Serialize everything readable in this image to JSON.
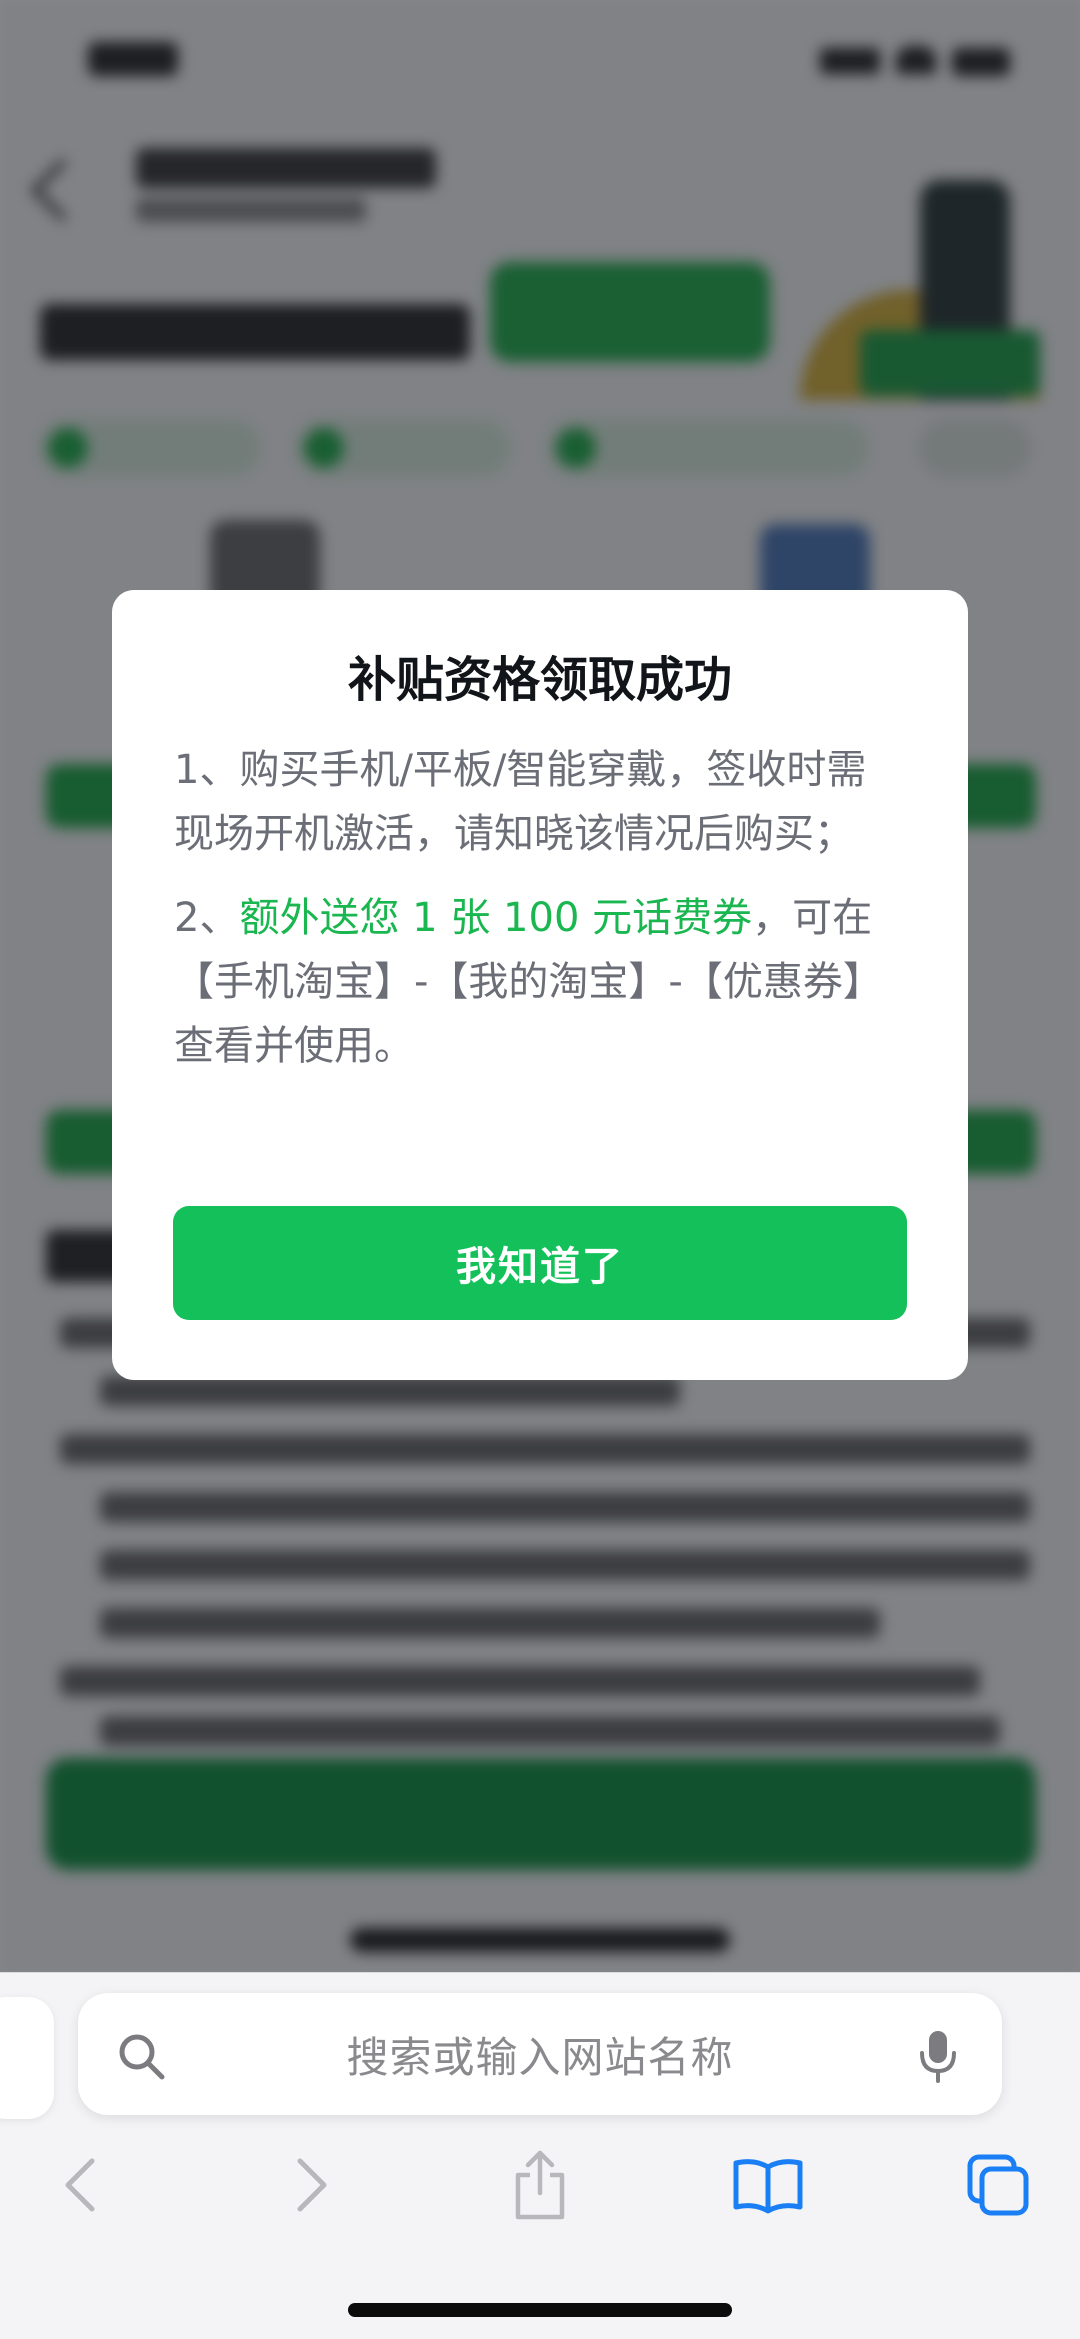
{
  "modal": {
    "title": "补贴资格领取成功",
    "para1": "1、购买手机/平板/智能穿戴，签收时需现场开机激活，请知晓该情况后购买；",
    "para2_prefix": "2、",
    "para2_highlight": "额外送您 1 张 100 元话费券",
    "para2_suffix": "，可在【手机淘宝】-【我的淘宝】-【优惠券】查看并使用。",
    "button_label": "我知道了"
  },
  "browser": {
    "search_placeholder": "搜索或输入网站名称",
    "icons": [
      "search-icon",
      "mic-icon",
      "back-icon",
      "forward-icon",
      "share-icon",
      "bookmarks-icon",
      "tabs-icon"
    ]
  },
  "colors": {
    "accent": "#14c05a",
    "highlight_text": "#1ab650",
    "browser_tint": "#1a7ef5",
    "toolbar_disabled": "#b8b8bc"
  }
}
